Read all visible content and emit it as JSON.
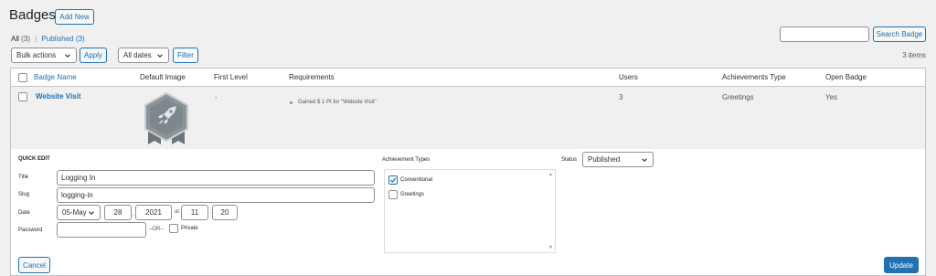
{
  "header": {
    "title": "Badges",
    "add_new": "Add New"
  },
  "views": {
    "all_label": "All",
    "all_count": "(3)",
    "sep": "|",
    "published_label": "Published",
    "published_count": "(3)"
  },
  "search": {
    "value": "",
    "button": "Search Badge"
  },
  "tablenav": {
    "bulk_actions": "Bulk actions",
    "apply": "Apply",
    "dates": "All dates",
    "filter": "Filter",
    "items": "3 items"
  },
  "table": {
    "columns": [
      "Badge Name",
      "Default Image",
      "First Level",
      "Requirements",
      "Users",
      "Achievements Type",
      "Open Badge"
    ],
    "row": {
      "name": "Website Visit",
      "first_level": "-",
      "requirement": "Gained $ 1 Pt for \"Website Visit\"",
      "users": "3",
      "achievement_type": "Greetings",
      "open_badge": "Yes"
    }
  },
  "quick_edit": {
    "heading": "QUICK EDIT",
    "title_label": "Title",
    "title_value": "Logging In",
    "slug_label": "Slug",
    "slug_value": "logging-in",
    "date_label": "Date",
    "month": "05-May",
    "day": "28",
    "year": "2021",
    "at": "at",
    "hour": "11",
    "minute": "20",
    "comma": ",",
    "colon": ":",
    "password_label": "Password",
    "password_value": "",
    "or": "–OR–",
    "private_label": "Private",
    "achievement_types_label": "Achievement Types",
    "achievement_types": [
      {
        "label": "Conventional",
        "checked": true
      },
      {
        "label": "Greetings",
        "checked": false
      }
    ],
    "status_label": "Status",
    "status_value": "Published",
    "cancel": "Cancel",
    "update": "Update"
  },
  "colors": {
    "accent": "#2271b1",
    "badge_hex": "#8a9499",
    "badge_ribbon": "#6d7579"
  }
}
